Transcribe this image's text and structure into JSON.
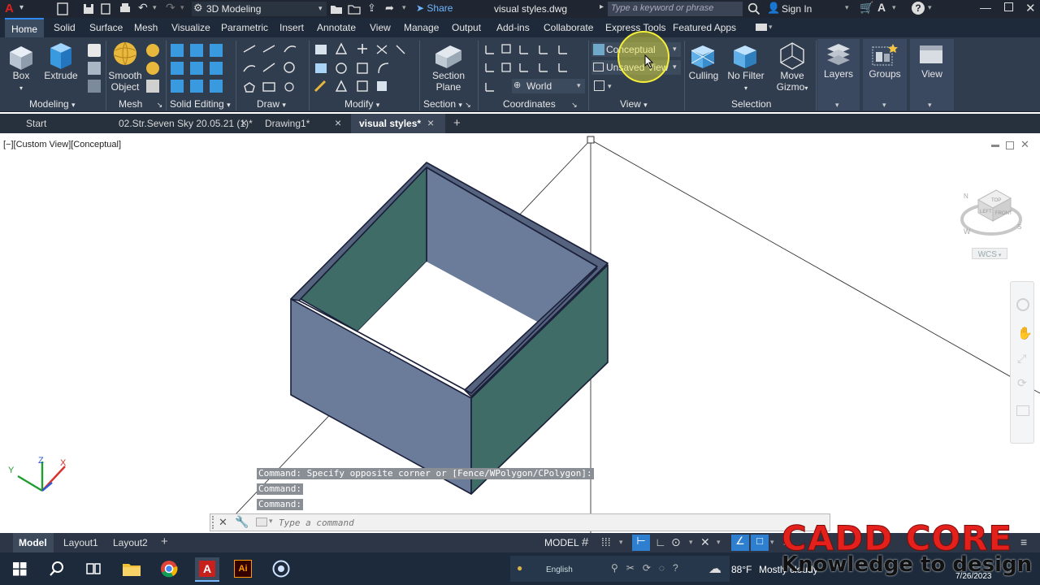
{
  "titlebar": {
    "workspace": "3D Modeling",
    "share": "Share",
    "filename": "visual styles.dwg",
    "search_placeholder": "Type a keyword or phrase",
    "sign_in": "Sign In"
  },
  "ribbon_tabs": [
    "Home",
    "Solid",
    "Surface",
    "Mesh",
    "Visualize",
    "Parametric",
    "Insert",
    "Annotate",
    "View",
    "Manage",
    "Output",
    "Add-ins",
    "Collaborate",
    "Express Tools",
    "Featured Apps"
  ],
  "ribbon": {
    "box": "Box",
    "extrude": "Extrude",
    "smooth_object_1": "Smooth",
    "smooth_object_2": "Object",
    "section_plane_1": "Section",
    "section_plane_2": "Plane",
    "visual_style": "Conceptual",
    "view_name": "Unsaved View",
    "ucs": "World",
    "culling": "Culling",
    "no_filter": "No Filter",
    "move_gizmo_1": "Move",
    "move_gizmo_2": "Gizmo",
    "layers": "Layers",
    "groups": "Groups",
    "view": "View"
  },
  "panels": {
    "modeling": "Modeling",
    "mesh": "Mesh",
    "solid_editing": "Solid Editing",
    "draw": "Draw",
    "modify": "Modify",
    "section": "Section",
    "coordinates": "Coordinates",
    "view": "View",
    "selection": "Selection"
  },
  "doc_tabs": [
    "Start",
    "02.Str.Seven Sky 20.05.21 (1)*",
    "Drawing1*",
    "visual styles*"
  ],
  "viewport": {
    "label": "[−][Custom View][Conceptual]",
    "wcs": "WCS",
    "cube_top": "TOP",
    "cube_left": "LEFT",
    "cube_front": "FRONT",
    "compass_n": "N",
    "compass_w": "W",
    "compass_s": "S",
    "axis_x": "X",
    "axis_y": "Y",
    "axis_z": "Z"
  },
  "command": {
    "history": [
      "Command: Specify opposite corner or [Fence/WPolygon/CPolygon]:",
      "Command:",
      "Command:"
    ],
    "placeholder": "Type a command"
  },
  "layout_tabs": [
    "Model",
    "Layout1",
    "Layout2"
  ],
  "status": {
    "model": "MODEL"
  },
  "taskbar": {
    "language": "English",
    "temperature": "88°F",
    "weather": "Mostly cloudy",
    "date": "7/26/2023"
  },
  "watermark": {
    "brand": "CADD CORE",
    "tagline": "Knowledge to design"
  },
  "colors": {
    "wall_blue": "#6b7c9a",
    "wall_green": "#3f6c66",
    "ribbon_bg": "#303d4f",
    "highlight": "#f5ef3a",
    "watermark_red": "#e3201b"
  }
}
